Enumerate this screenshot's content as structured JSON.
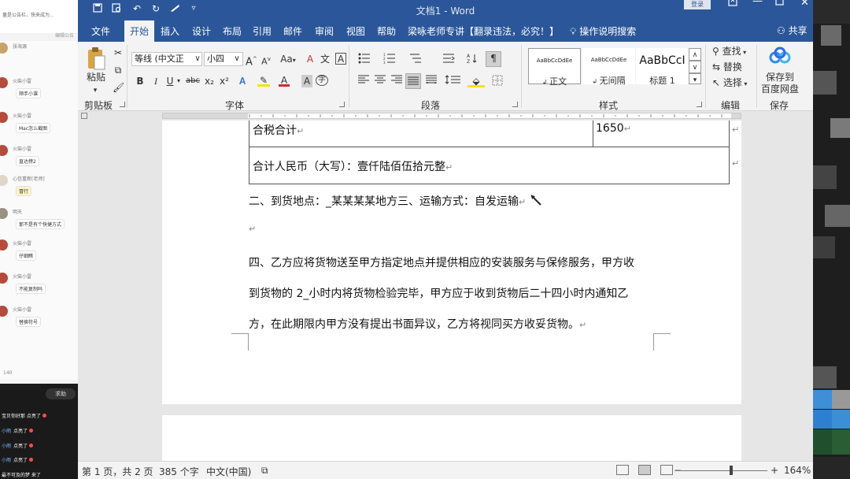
{
  "window": {
    "title": "文档1  -  Word",
    "login_label": "登录",
    "minimize_glyph": "—",
    "close_glyph": "✕"
  },
  "tabs": [
    {
      "label": "文件",
      "active": false
    },
    {
      "label": "开始",
      "active": true
    },
    {
      "label": "插入",
      "active": false
    },
    {
      "label": "设计",
      "active": false
    },
    {
      "label": "布局",
      "active": false
    },
    {
      "label": "引用",
      "active": false
    },
    {
      "label": "邮件",
      "active": false
    },
    {
      "label": "审阅",
      "active": false
    },
    {
      "label": "视图",
      "active": false
    },
    {
      "label": "帮助",
      "active": false
    },
    {
      "label": "梁咏老师专讲【翻录违法，必究！】",
      "active": false
    }
  ],
  "tell_me": "操作说明搜索",
  "share_label": "共享",
  "ribbon": {
    "clipboard": {
      "paste_label": "粘贴",
      "group_label": "剪贴板"
    },
    "font": {
      "font_name": "等线 (中文正",
      "font_size": "小四",
      "grow_glyph": "A",
      "shrink_glyph": "A",
      "case_glyph": "Aa",
      "clear_glyph": "A",
      "charborder_glyph": "A",
      "bold": "B",
      "italic": "I",
      "underline": "U",
      "strike": "abc",
      "sub": "x₂",
      "sup": "x²",
      "font_color_glyph": "A",
      "shading_glyph": "A",
      "enclose_glyph": "字",
      "group_label": "字体"
    },
    "paragraph": {
      "group_label": "段落"
    },
    "styles": {
      "items": [
        {
          "preview": "AaBbCcDdEe",
          "label": "正文"
        },
        {
          "preview": "AaBbCcDdEe",
          "label": "无间隔"
        },
        {
          "preview": "AaBbCcI",
          "label": "标题 1"
        }
      ],
      "group_label": "样式"
    },
    "editing": {
      "find": "查找",
      "replace": "替换",
      "select": "选择",
      "group_label": "编辑"
    },
    "save": {
      "label1": "保存到",
      "label2": "百度网盘",
      "group_label": "保存"
    }
  },
  "document": {
    "table": {
      "row1_col1": "合税合计",
      "row1_col2": "1650",
      "row2": "合计人民币（大写）：壹仟陆佰伍拾元整"
    },
    "para1": "二、到货地点：_某某某某地方三、运输方式：自发运输",
    "para2_line1": "四、乙方应将货物送至甲方指定地点并提供相应的安装服务与保修服务，甲方收",
    "para2_line2": "到货物的  2_小时内将货物检验完毕，甲方应于收到货物后二十四小时内通知乙",
    "para2_line3": "方，在此期限内甲方没有提出书面异议，乙方将视同买方收妥货物。",
    "para_mark": "↵"
  },
  "status_bar": {
    "page": "第 1 页，共 2 页",
    "words": "385 个字",
    "language": "中文(中国)",
    "zoom": "164%",
    "zoom_minus": "−",
    "zoom_plus": "+"
  },
  "chat": {
    "header": "量是公告栏，快来成为...",
    "header2": "编辑公告",
    "users": [
      {
        "name": "张海源",
        "msg": ""
      },
      {
        "name": "火柴小雷",
        "msg": "顺手小课"
      },
      {
        "name": "火柴小雷",
        "msg": "Mac怎么截图"
      },
      {
        "name": "火柴小雷",
        "msg": "直达榜2"
      },
      {
        "name": "心信重新[老师]",
        "msg": "冒行"
      },
      {
        "name": "明天",
        "msg": "那不是有个快捷方式"
      },
      {
        "name": "火柴小雷",
        "msg": "仔细瞧"
      },
      {
        "name": "火柴小雷",
        "msg": "不能复制吗"
      },
      {
        "name": "火柴小雷",
        "msg": "替换符号"
      }
    ],
    "count": "140",
    "join": "求助",
    "live": [
      {
        "user": "",
        "msg": "宝贝你好那  点亮了"
      },
      {
        "user": "小雨",
        "msg": "点亮了"
      },
      {
        "user": "小雨",
        "msg": "点亮了"
      },
      {
        "user": "小雨",
        "msg": "点亮了"
      },
      {
        "user": "",
        "msg": "最不可及的梦  来了"
      }
    ]
  },
  "colors": {
    "accent": "#2b579a",
    "ribbon_bg": "#f3f3f3",
    "doc_bg": "#e6e6e6",
    "live_user": "#6fb8ff",
    "live_dot": "#ff4b4b"
  }
}
